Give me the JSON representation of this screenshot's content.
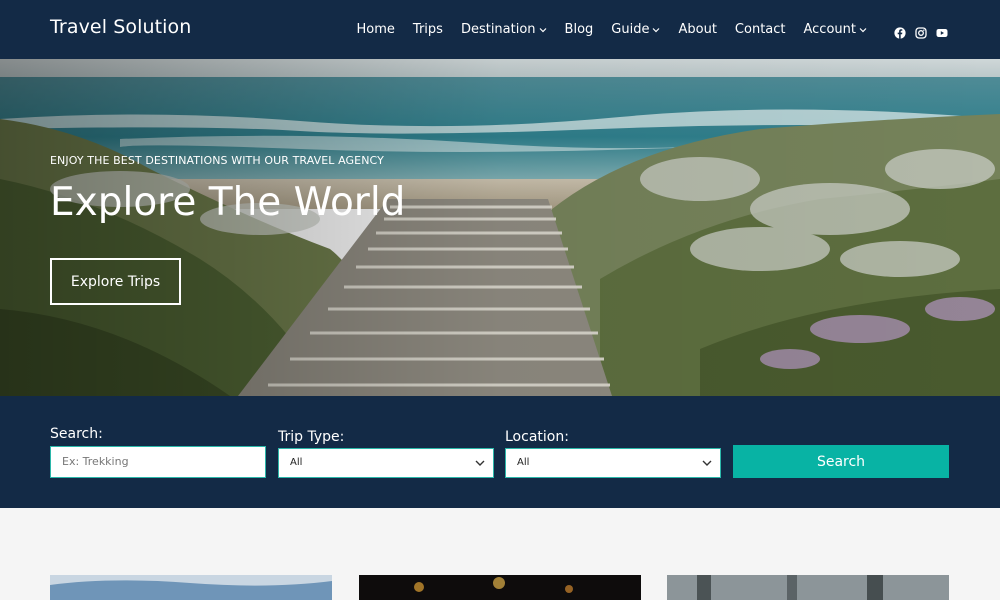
{
  "header": {
    "brand": "Travel Solution",
    "nav": [
      {
        "label": "Home",
        "dropdown": false
      },
      {
        "label": "Trips",
        "dropdown": false
      },
      {
        "label": "Destination",
        "dropdown": true
      },
      {
        "label": "Blog",
        "dropdown": false
      },
      {
        "label": "Guide",
        "dropdown": true
      },
      {
        "label": "About",
        "dropdown": false
      },
      {
        "label": "Contact",
        "dropdown": false
      },
      {
        "label": "Account",
        "dropdown": true
      }
    ],
    "social": [
      "facebook-icon",
      "instagram-icon",
      "youtube-icon"
    ]
  },
  "hero": {
    "eyebrow": "ENJOY THE BEST DESTINATIONS WITH OUR TRAVEL AGENCY",
    "title": "Explore The World",
    "button": "Explore Trips"
  },
  "search": {
    "search_label": "Search:",
    "search_placeholder": "Ex: Trekking",
    "trip_type_label": "Trip Type:",
    "trip_type_value": "All",
    "location_label": "Location:",
    "location_value": "All",
    "button": "Search"
  },
  "colors": {
    "navy": "#132a46",
    "teal": "#08b3a4",
    "background": "#f5f5f5"
  }
}
